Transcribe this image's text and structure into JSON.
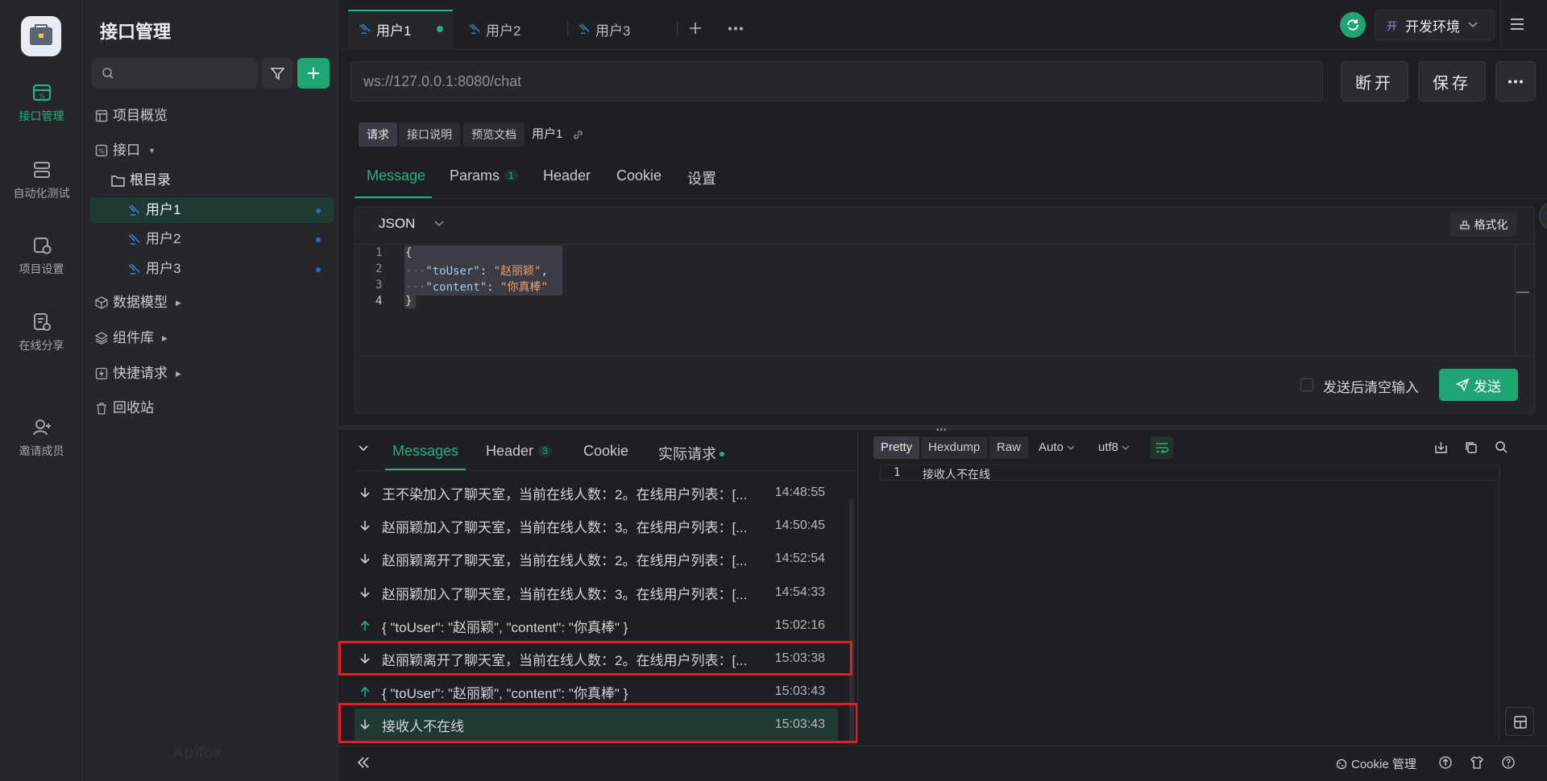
{
  "rail": {
    "items": [
      {
        "label": "接口管理",
        "icon": "api-management-icon",
        "active": true
      },
      {
        "label": "自动化测试",
        "icon": "automation-test-icon"
      },
      {
        "label": "项目设置",
        "icon": "project-settings-icon"
      },
      {
        "label": "在线分享",
        "icon": "online-share-icon"
      },
      {
        "label": "邀请成员",
        "icon": "invite-member-icon"
      }
    ]
  },
  "sidebar": {
    "title": "接口管理",
    "search_placeholder": "",
    "overview": "项目概览",
    "api": "接口",
    "root": "根目录",
    "endpoints": [
      "用户1",
      "用户2",
      "用户3"
    ],
    "data_model": "数据模型",
    "components": "组件库",
    "quick_request": "快捷请求",
    "trash": "回收站",
    "watermark": "Apifox"
  },
  "tabs": [
    {
      "label": "用户1",
      "active": true,
      "dot": true
    },
    {
      "label": "用户2"
    },
    {
      "label": "用户3"
    }
  ],
  "top_right": {
    "env_prefix": "开",
    "env_label": "开发环境"
  },
  "request": {
    "url": "ws://127.0.0.1:8080/chat",
    "disconnect": "断开",
    "save": "保存"
  },
  "sub_tabs": {
    "request": "请求",
    "doc": "接口说明",
    "preview": "预览文档",
    "name": "用户1"
  },
  "main_tabs": {
    "message": "Message",
    "params": "Params",
    "params_count": "1",
    "header": "Header",
    "cookie": "Cookie",
    "settings": "设置"
  },
  "editor": {
    "format_select": "JSON",
    "format_btn": "格式化",
    "line_numbers": [
      "1",
      "2",
      "3",
      "4"
    ],
    "lines": {
      "l1": "{",
      "l2_key": "\"toUser\"",
      "l2_val": "\"赵丽颖\"",
      "l3_key": "\"content\"",
      "l3_val": "\"你真棒\"",
      "l4": "}"
    },
    "clear_after_send": "发送后清空输入",
    "send": "发送"
  },
  "messages_panel": {
    "tabs": {
      "messages": "Messages",
      "header": "Header",
      "header_count": "3",
      "cookie": "Cookie",
      "actual": "实际请求"
    },
    "rows": [
      {
        "dir": "down",
        "text": "王不染加入了聊天室，当前在线人数：2。在线用户列表：[...",
        "time": "14:48:55"
      },
      {
        "dir": "down",
        "text": "赵丽颖加入了聊天室，当前在线人数：3。在线用户列表：[...",
        "time": "14:50:45"
      },
      {
        "dir": "down",
        "text": "赵丽颖离开了聊天室，当前在线人数：2。在线用户列表：[...",
        "time": "14:52:54"
      },
      {
        "dir": "down",
        "text": "赵丽颖加入了聊天室，当前在线人数：3。在线用户列表：[...",
        "time": "14:54:33"
      },
      {
        "dir": "up",
        "text": "{ \"toUser\": \"赵丽颖\", \"content\": \"你真棒\" }",
        "time": "15:02:16"
      },
      {
        "dir": "down",
        "text": "赵丽颖离开了聊天室，当前在线人数：2。在线用户列表：[...",
        "time": "15:03:38"
      },
      {
        "dir": "up",
        "text": "{ \"toUser\": \"赵丽颖\", \"content\": \"你真棒\" }",
        "time": "15:03:43"
      },
      {
        "dir": "down",
        "text": "接收人不在线",
        "time": "15:03:43"
      }
    ]
  },
  "response": {
    "views": {
      "pretty": "Pretty",
      "hexdump": "Hexdump",
      "raw": "Raw",
      "auto": "Auto",
      "encoding": "utf8"
    },
    "line_no": "1",
    "line_text": "接收人不在线"
  },
  "footer": {
    "cookie_mgmt": "Cookie 管理"
  },
  "colors": {
    "accent": "#22b27a",
    "highlight": "#e21f26"
  }
}
